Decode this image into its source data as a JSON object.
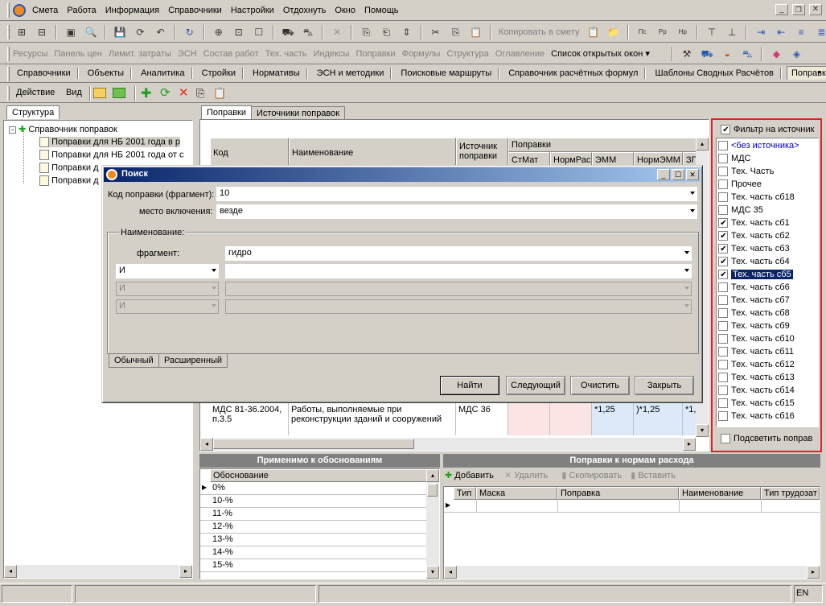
{
  "menu": {
    "items": [
      "Смета",
      "Работа",
      "Информация",
      "Справочники",
      "Настройки",
      "Отдохнуть",
      "Окно",
      "Помощь"
    ]
  },
  "toolbar2": {
    "copy_to_estimate": "Копировать в смету"
  },
  "toolbar3": {
    "items": [
      "Ресурсы",
      "Панель цен",
      "Лимит. затраты",
      "ЭСН",
      "Состав работ",
      "Тех. часть",
      "Индексы",
      "Поправки",
      "Формулы",
      "Структура",
      "Оглавление"
    ],
    "open_windows": "Список открытых окон"
  },
  "doc_tabs": [
    "Справочники",
    "Объекты",
    "Аналитика",
    "Стройки",
    "Нормативы",
    "ЭСН и методики",
    "Поисковые маршруты",
    "Справочник расчётных формул",
    "Шаблоны Сводных Расчётов",
    "Поправки"
  ],
  "action_bar": {
    "action": "Действие",
    "view": "Вид"
  },
  "left": {
    "tab": "Структура",
    "root": "Справочник поправок",
    "children": [
      "Поправки  для НБ 2001 года  в р",
      "Поправки  для НБ 2001 года от с",
      "Поправки д",
      "Поправки д"
    ]
  },
  "main_tabs": [
    "Поправки",
    "Источники поправок"
  ],
  "grid": {
    "col_code": "Код",
    "col_name": "Наименование",
    "col_source": "Источник поправки",
    "group_corrections": "Поправки",
    "sub_cols": [
      "СтМат",
      "НормРас",
      "ЭММ",
      "НормЭММ",
      "ЗП"
    ],
    "row": {
      "code": "МДС 81-36.2004, п.3.5",
      "name": "Работы, выполняемые при реконструкции зданий и сооружений",
      "source": "МДС 36",
      "emm": "*1,25",
      "norm_emm": ")*1,25",
      "zp": "*1,"
    }
  },
  "applied": {
    "title": "Применимо к обоснованиям",
    "col": "Обоснование",
    "rows": [
      "0%",
      "10-%",
      "11-%",
      "12-%",
      "13-%",
      "14-%",
      "15-%"
    ]
  },
  "norms": {
    "title": "Поправки к нормам расхода",
    "add": "Добавить",
    "delete": "Удалить",
    "copy": "Скопировать",
    "paste": "Вставить",
    "cols": [
      "Тип",
      "Маска",
      "Поправка",
      "Наименование",
      "Тип трудозат"
    ]
  },
  "filter": {
    "title": "Фильтр на источник",
    "items": [
      {
        "label": "<без источника>",
        "checked": false,
        "blue": true
      },
      {
        "label": "МДС",
        "checked": false
      },
      {
        "label": "Тех. Часть",
        "checked": false
      },
      {
        "label": "Прочее",
        "checked": false
      },
      {
        "label": "Тех. часть сб18",
        "checked": false
      },
      {
        "label": "МДС 35",
        "checked": false
      },
      {
        "label": "Тех. часть сб1",
        "checked": true
      },
      {
        "label": "Тех. часть сб2",
        "checked": true
      },
      {
        "label": "Тех. часть сб3",
        "checked": true
      },
      {
        "label": "Тех. часть сб4",
        "checked": true
      },
      {
        "label": "Тех. часть сб5",
        "checked": true,
        "selected": true
      },
      {
        "label": "Тех. часть сб6",
        "checked": false
      },
      {
        "label": "Тех. часть сб7",
        "checked": false
      },
      {
        "label": "Тех. часть сб8",
        "checked": false
      },
      {
        "label": "Тех. часть сб9",
        "checked": false
      },
      {
        "label": "Тех. часть сб10",
        "checked": false
      },
      {
        "label": "Тех. часть сб11",
        "checked": false
      },
      {
        "label": "Тех. часть сб12",
        "checked": false
      },
      {
        "label": "Тех. часть сб13",
        "checked": false
      },
      {
        "label": "Тех. часть сб14",
        "checked": false
      },
      {
        "label": "Тех. часть сб15",
        "checked": false
      },
      {
        "label": "Тех. часть сб16",
        "checked": false
      }
    ],
    "highlight": "Подсветить поправ"
  },
  "dialog": {
    "title": "Поиск",
    "code_label": "Код поправки (фрагмент):",
    "code_value": "10",
    "place_label": "место включения:",
    "place_value": "везде",
    "name_group": "Наименование:",
    "fragment_label": "фрагмент:",
    "fragment_value": "гидро",
    "op1": "И",
    "op2": "И",
    "op3": "И",
    "tab_simple": "Обычный",
    "tab_advanced": "Расширенный",
    "btn_find": "Найти",
    "btn_next": "Следующий",
    "btn_clear": "Очистить",
    "btn_close": "Закрыть"
  },
  "status": {
    "lang": "EN"
  },
  "colors": {
    "accent_red": "#e0212b",
    "selection": "#0a246a",
    "title_start": "#0a246a",
    "title_end": "#a6caf0"
  }
}
